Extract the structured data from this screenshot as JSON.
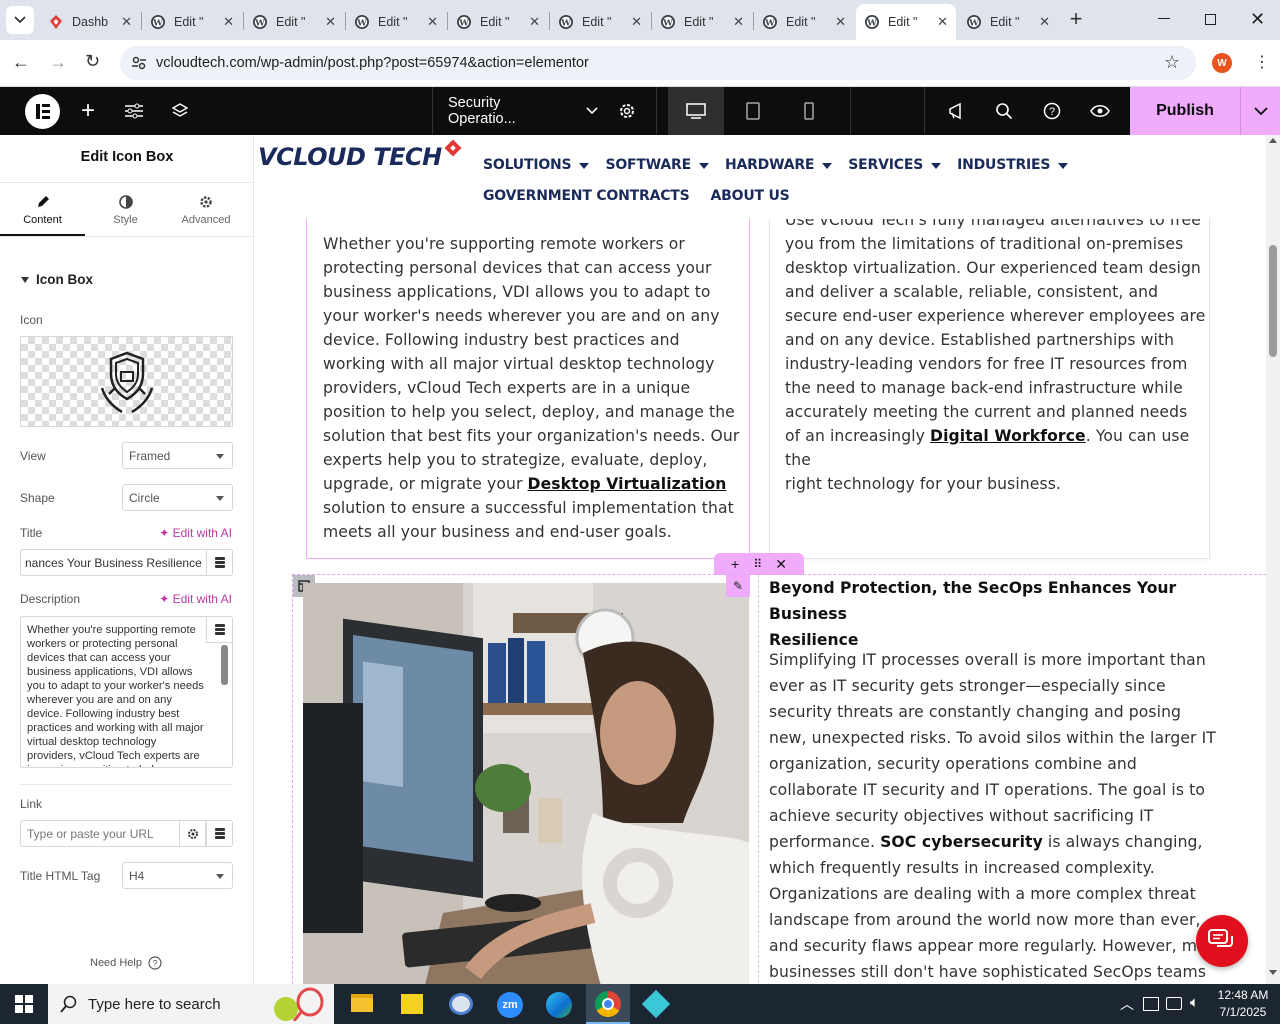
{
  "browser": {
    "tabs": [
      {
        "title": "Dashb",
        "active": false
      },
      {
        "title": "Edit \"",
        "active": false
      },
      {
        "title": "Edit \"",
        "active": false
      },
      {
        "title": "Edit \"",
        "active": false
      },
      {
        "title": "Edit \"",
        "active": false
      },
      {
        "title": "Edit \"",
        "active": false
      },
      {
        "title": "Edit \"",
        "active": false
      },
      {
        "title": "Edit \"",
        "active": false
      },
      {
        "title": "Edit \"",
        "active": true
      },
      {
        "title": "Edit \"",
        "active": false
      }
    ],
    "url": "vcloudtech.com/wp-admin/post.php?post=65974&action=elementor",
    "profile_initial": "W"
  },
  "editor": {
    "page_name": "Security Operatio...",
    "publish_label": "Publish",
    "panel_title": "Edit Icon Box",
    "panel_tabs": [
      {
        "label": "Content",
        "icon": "pencil-icon"
      },
      {
        "label": "Style",
        "icon": "half-circle-icon"
      },
      {
        "label": "Advanced",
        "icon": "gear-icon"
      }
    ],
    "section_title": "Icon Box",
    "icon_label": "Icon",
    "view_label": "View",
    "view_value": "Framed",
    "shape_label": "Shape",
    "shape_value": "Circle",
    "title_label": "Title",
    "edit_ai": "Edit with AI",
    "title_value": "nances Your Business Resilience",
    "description_label": "Description",
    "description_value": "Whether you're supporting remote workers or protecting personal devices that can access your business applications, VDI allows you to adapt to your worker's needs wherever you are and on any device. Following industry best practices and working with all major virtual desktop technology providers, vCloud Tech experts are in a unique position to help you",
    "link_label": "Link",
    "link_placeholder": "Type or paste your URL",
    "html_tag_label": "Title HTML Tag",
    "html_tag_value": "H4",
    "need_help": "Need Help"
  },
  "site": {
    "logo_text": "VCLOUD TECH",
    "nav": [
      "SOLUTIONS",
      "SOFTWARE",
      "HARDWARE",
      "SERVICES",
      "INDUSTRIES"
    ],
    "nav2": [
      "GOVERNMENT CONTRACTS",
      "ABOUT US"
    ],
    "left_box_lines": [
      "Whether you're supporting remote workers or",
      "protecting personal devices that can access your",
      "business applications, VDI allows you to adapt to",
      "your worker's needs wherever you are and on any",
      "device. Following industry best practices and",
      "working with all major virtual desktop technology",
      "providers, vCloud Tech experts are in a unique",
      "position to help you select, deploy, and manage the",
      "solution that best fits your organization's needs. Our",
      "experts help you to strategize, evaluate, deploy,"
    ],
    "left_box_pre_link": "upgrade, or migrate your ",
    "left_box_link": "Desktop Virtualization",
    "left_box_tail": [
      "solution to ensure a successful implementation that",
      "meets all your business and end-user goals."
    ],
    "right_box_lines": [
      "Use vCloud Tech's fully managed alternatives to free",
      "you from the limitations of traditional on-premises",
      "desktop virtualization. Our experienced team design",
      "and deliver a scalable, reliable, consistent, and",
      "secure end-user experience wherever employees are",
      "and on any device. Established partnerships with",
      "industry-leading vendors for free IT resources from",
      "the need to manage back-end infrastructure while",
      "accurately meeting the current and planned needs"
    ],
    "right_box_pre_link": "of an increasingly ",
    "right_box_link": "Digital Workforce",
    "right_box_post_link": ". You can use the",
    "right_box_last": "right technology for your business.",
    "secops_title": [
      "Beyond Protection, the SecOps Enhances Your Business",
      "Resilience"
    ],
    "secops_lines_a": [
      "Simplifying IT processes overall is more important than",
      "ever as IT security gets stronger—especially since",
      "security threats are constantly changing and posing",
      "new, unexpected risks. To avoid silos within the larger IT",
      "organization, security operations combine and",
      "collaborate IT security and IT operations. The goal is to",
      "achieve security objectives without sacrificing IT"
    ],
    "secops_pre_bold": "performance. ",
    "secops_bold": "SOC cybersecurity",
    "secops_post_bold": " is always changing,",
    "secops_lines_b": [
      "which frequently results in increased complexity.",
      "Organizations are dealing with a more complex threat",
      "landscape from around the world now more than ever,",
      "and security flaws appear more regularly. However, man",
      "businesses still don't have sophisticated SecOps teams"
    ]
  },
  "taskbar": {
    "search_placeholder": "Type here to search",
    "time": "12:48 AM",
    "date": "7/1/2025"
  },
  "colors": {
    "accent": "#d004d4",
    "publish_bg": "#f0abfc",
    "brand_red": "#e53935",
    "elementor_pink": "#c036a6"
  }
}
